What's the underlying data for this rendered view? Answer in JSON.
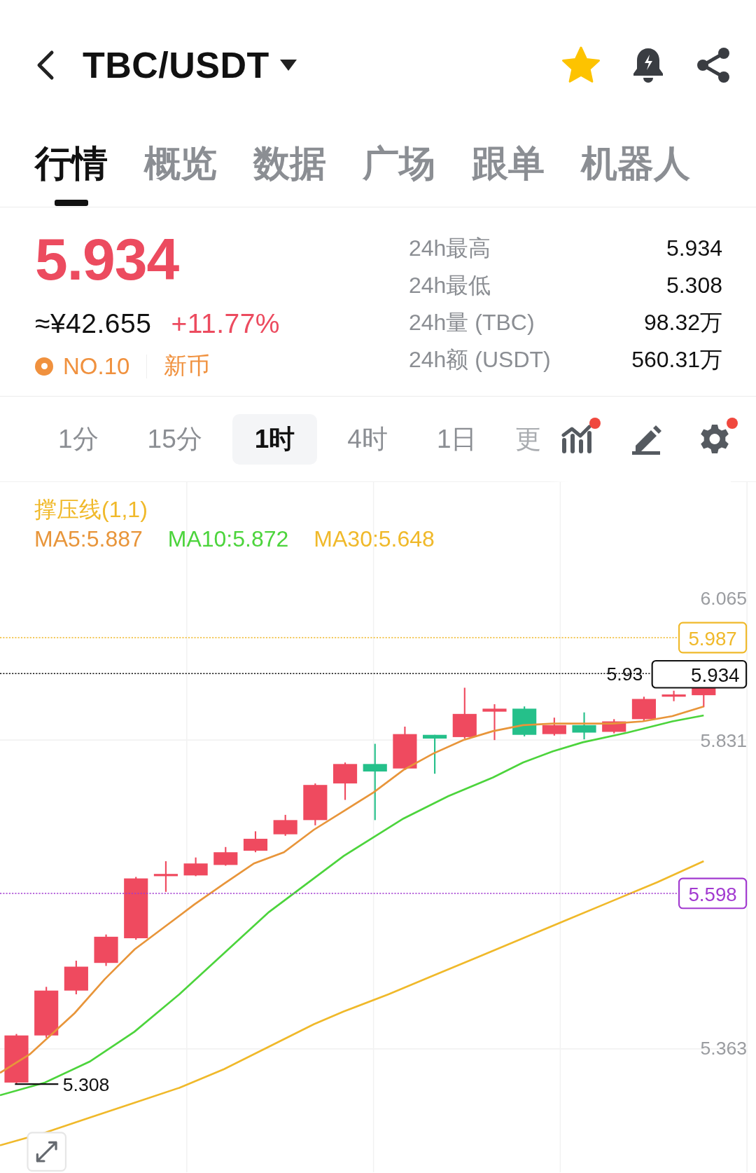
{
  "header": {
    "title": "TBC/USDT",
    "favorited": true
  },
  "tabs": [
    {
      "label": "行情",
      "selected": true
    },
    {
      "label": "概览",
      "selected": false
    },
    {
      "label": "数据",
      "selected": false
    },
    {
      "label": "广场",
      "selected": false
    },
    {
      "label": "跟单",
      "selected": false
    },
    {
      "label": "机器人",
      "selected": false
    }
  ],
  "ticker": {
    "price": "5.934",
    "cny": "≈¥42.655",
    "change": "+11.77%",
    "rank": "NO.10",
    "tag": "新币",
    "stats": [
      {
        "label": "24h最高",
        "value": "5.934"
      },
      {
        "label": "24h最低",
        "value": "5.308"
      },
      {
        "label": "24h量 (TBC)",
        "value": "98.32万"
      },
      {
        "label": "24h额 (USDT)",
        "value": "560.31万"
      }
    ]
  },
  "intervals": [
    {
      "label": "1分",
      "selected": false
    },
    {
      "label": "15分",
      "selected": false
    },
    {
      "label": "1时",
      "selected": true
    },
    {
      "label": "4时",
      "selected": false
    },
    {
      "label": "1日",
      "selected": false
    },
    {
      "label": "更",
      "selected": false
    }
  ],
  "tools": [
    {
      "kind": "indicator",
      "badge": true
    },
    {
      "kind": "draw",
      "badge": false
    },
    {
      "kind": "settings",
      "badge": true
    }
  ],
  "chart": {
    "indicator": "撑压线(1,1)",
    "ma": [
      {
        "label": "MA5:5.887",
        "color": "#e8953a"
      },
      {
        "label": "MA10:5.872",
        "color": "#4cd43c"
      },
      {
        "label": "MA30:5.648",
        "color": "#f0b92a"
      }
    ],
    "axis_labels": [
      "6.065",
      "5.831",
      "5.363"
    ],
    "lines": [
      {
        "kind": "resistance",
        "value": "5.987",
        "color": "#f0b92a"
      },
      {
        "kind": "last",
        "value": "5.934",
        "marker": "5.93"
      },
      {
        "kind": "support",
        "value": "5.598",
        "color": "#a23ad0"
      }
    ],
    "low_label": "5.308"
  }
}
